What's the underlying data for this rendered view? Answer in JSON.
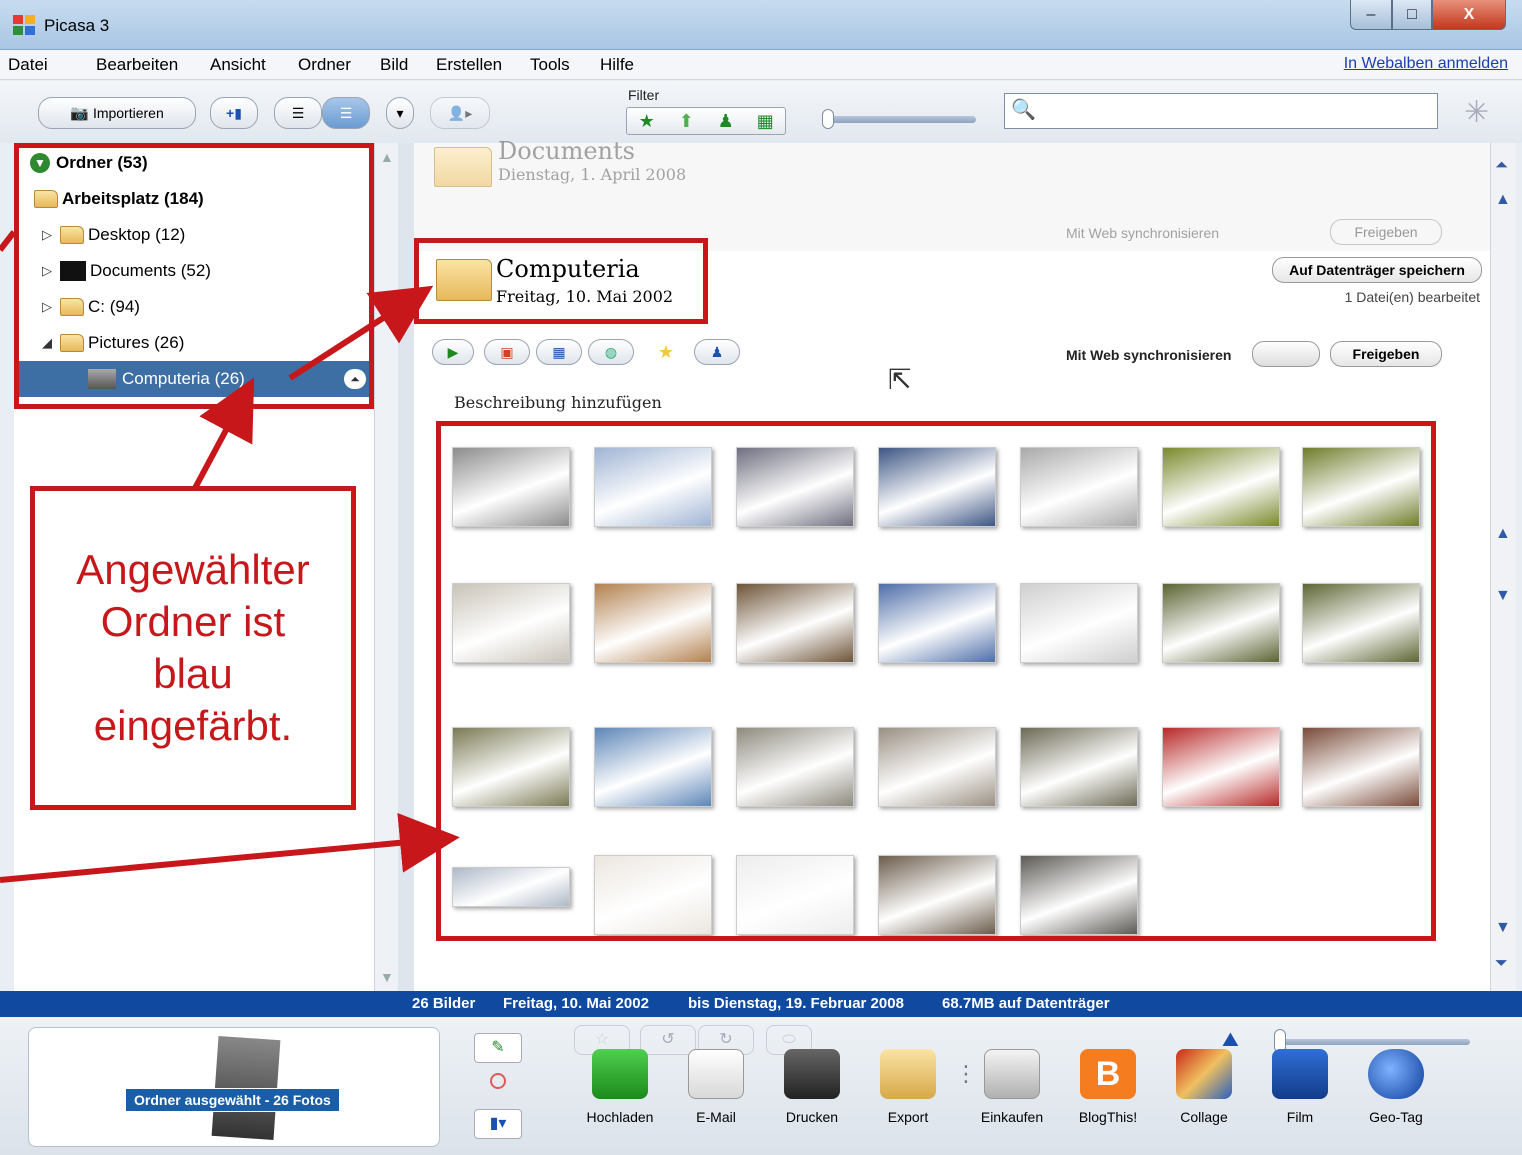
{
  "window": {
    "title": "Picasa 3",
    "min": "–",
    "max": "□",
    "close": "X"
  },
  "menu": {
    "items": [
      "Datei",
      "Bearbeiten",
      "Ansicht",
      "Ordner",
      "Bild",
      "Erstellen",
      "Tools",
      "Hilfe"
    ],
    "signin": "In Webalben anmelden"
  },
  "toolbar": {
    "import_label": "Importieren",
    "filter_label": "Filter"
  },
  "folders": {
    "root": "Ordner (53)",
    "workspace": "Arbeitsplatz (184)",
    "desktop": "Desktop (12)",
    "documents": "Documents (52)",
    "c_drive": "C: (94)",
    "pictures": "Pictures (26)",
    "selected": "Computeria (26)"
  },
  "documents_album": {
    "title": "Documents",
    "date": "Dienstag, 1. April 2008",
    "sync_label": "Mit Web synchronisieren",
    "share_label": "Freigeben"
  },
  "album": {
    "title": "Computeria",
    "date": "Freitag, 10. Mai 2002",
    "save_label": "Auf Datenträger speichern",
    "edited_note": "1 Datei(en) bearbeitet",
    "sync_label": "Mit Web synchronisieren",
    "share_label": "Freigeben",
    "description_placeholder": "Beschreibung hinzufügen"
  },
  "status": {
    "count": "26 Bilder",
    "from": "Freitag, 10. Mai 2002",
    "to": "bis Dienstag, 19. Februar 2008",
    "size": "68.7MB auf Datenträger"
  },
  "tray": {
    "label": "Ordner ausgewählt - 26 Fotos"
  },
  "actions": [
    "Hochladen",
    "E-Mail",
    "Drucken",
    "Export",
    "Einkaufen",
    "BlogThis!",
    "Collage",
    "Film",
    "Geo-Tag"
  ],
  "annotation": {
    "line1": "Angewählter",
    "line2": "Ordner ist",
    "line3": "blau",
    "line4": "eingefärbt.",
    "color": "#c8171b"
  },
  "thumb_colors": [
    "#8c8c8c",
    "#9fb4d4",
    "#6f6f80",
    "#3e5684",
    "#a9a9a9",
    "#7a8a2c",
    "#6f7d2a",
    "#c9c3b8",
    "#b3814f",
    "#6e5438",
    "#4e6ea8",
    "#cfcfcf",
    "#5b6433",
    "#5d6634",
    "#7b7a55",
    "#5e86b8",
    "#8e8a7e",
    "#9a9083",
    "#6d6a55",
    "#b82929",
    "#7a4b3a",
    "#aeb9c8",
    "#ece6df",
    "#ededed",
    "#6c5d4c",
    "#5d5a55"
  ]
}
